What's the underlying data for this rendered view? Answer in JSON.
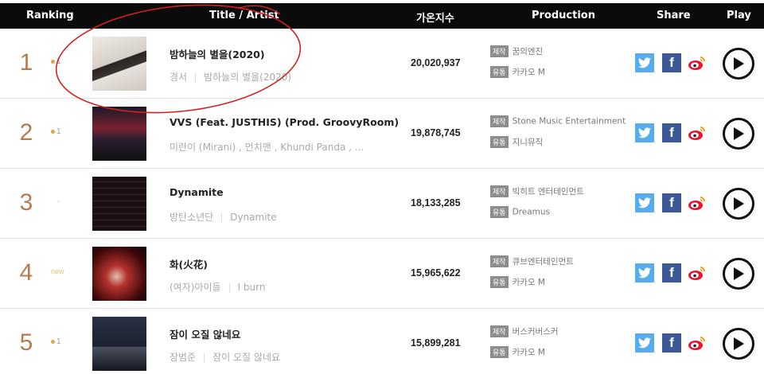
{
  "header": {
    "ranking": "Ranking",
    "title_artist": "Title / Artist",
    "index": "가온지수",
    "production": "Production",
    "share": "Share",
    "play": "Play"
  },
  "labels": {
    "produce_tag": "제작",
    "distribute_tag": "유통",
    "facebook_glyph": "f"
  },
  "rows": [
    {
      "rank": "1",
      "change": "1",
      "change_type": "up",
      "title": "밤하늘의 별을(2020)",
      "artist": "경서",
      "album": "밤하늘의 별을(2020)",
      "index": "20,020,937",
      "producer": "꿈의엔진",
      "distributor": "카카오 M"
    },
    {
      "rank": "2",
      "change": "1",
      "change_type": "up",
      "title": "VVS (Feat. JUSTHIS) (Prod. GroovyRoom)",
      "artist": "미란이 (Mirani) , 먼치맨 , Khundi Panda , ...",
      "album": "",
      "index": "19,878,745",
      "producer": "Stone Music Entertainment",
      "distributor": "지니뮤직"
    },
    {
      "rank": "3",
      "change": "-",
      "change_type": "same",
      "title": "Dynamite",
      "artist": "방탄소년단",
      "album": "Dynamite",
      "index": "18,133,285",
      "producer": "빅히트 엔터테인먼트",
      "distributor": "Dreamus"
    },
    {
      "rank": "4",
      "change": "new",
      "change_type": "new",
      "title": "화(火花)",
      "artist": "(여자)아이들",
      "album": "I burn",
      "index": "15,965,622",
      "producer": "큐브엔터테인먼트",
      "distributor": "카카오 M"
    },
    {
      "rank": "5",
      "change": "1",
      "change_type": "up",
      "title": "잠이 오질 않네요",
      "artist": "장범준",
      "album": "잠이 오질 않네요",
      "index": "15,899,281",
      "producer": "버스커버스커",
      "distributor": "카카오 M"
    }
  ],
  "icons": {
    "twitter": "twitter-icon",
    "facebook": "facebook-icon",
    "weibo": "weibo-icon",
    "play": "play-icon"
  },
  "colors": {
    "header_bg": "#0b0b0b",
    "rank": "#b97a4e",
    "twitter": "#55acee",
    "facebook": "#3b5998",
    "annotation": "#d42020"
  }
}
